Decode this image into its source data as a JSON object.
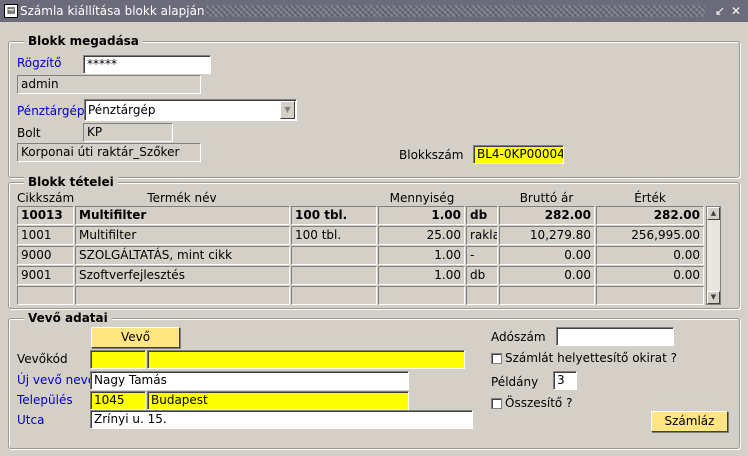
{
  "window": {
    "title": "Számla kiállítása blokk alapján",
    "icon": "oracle-forms-icon",
    "controls": [
      "↙",
      "✕"
    ]
  },
  "blokk_megadasa": {
    "legend": "Blokk megadása",
    "rogzito_label": "Rögzítő",
    "rogzito_value": "*****",
    "user": "admin",
    "penztargep_label": "Pénztárgép",
    "penztargep_value": "Pénztárgép",
    "bolt_label": "Bolt",
    "bolt_value": "KP",
    "raktar": "Korponai úti raktár_Szőker",
    "blokkszam_label": "Blokkszám",
    "blokkszam_value": "BL4-0KP00004"
  },
  "blokk_tetelei": {
    "legend": "Blokk tételei",
    "headers": [
      "Cikkszám",
      "Termék név",
      "Mennyiség",
      "Bruttó ár",
      "Érték"
    ],
    "rows": [
      {
        "cikkszam": "10013",
        "termek": "Multifilter",
        "kiszereles": "100 tbl.",
        "mennyiseg": "1.00",
        "egyseg": "db",
        "brutto": "282.00",
        "ertek": "282.00"
      },
      {
        "cikkszam": "1001",
        "termek": "Multifilter",
        "kiszereles": "100 tbl.",
        "mennyiseg": "25.00",
        "egyseg": "rakla",
        "brutto": "10,279.80",
        "ertek": "256,995.00"
      },
      {
        "cikkszam": "9000",
        "termek": "SZOLGÁLTATÁS, mint cikk",
        "kiszereles": "",
        "mennyiseg": "1.00",
        "egyseg": "-",
        "brutto": "0.00",
        "ertek": "0.00"
      },
      {
        "cikkszam": "9001",
        "termek": "Szoftverfejlesztés",
        "kiszereles": "",
        "mennyiseg": "1.00",
        "egyseg": "db",
        "brutto": "0.00",
        "ertek": "0.00"
      },
      {
        "cikkszam": "",
        "termek": "",
        "kiszereles": "",
        "mennyiseg": "",
        "egyseg": "",
        "brutto": "",
        "ertek": ""
      }
    ]
  },
  "vevo_adatai": {
    "legend": "Vevő adatai",
    "vevo_button": "Vevő",
    "vevokod_label": "Vevőkód",
    "vevokod_value": "",
    "vevokod_name": "",
    "uj_vevo_label": "Új vevő neve",
    "uj_vevo_value": "Nagy Tamás",
    "telepules_label": "Település",
    "irsz": "1045",
    "varos": "Budapest",
    "utca_label": "Utca",
    "utca_value": "Zrínyi u. 15.",
    "adoszam_label": "Adószám",
    "adoszam_value": "",
    "helyettesito_label": "Számlát helyettesítő okirat ?",
    "peldany_label": "Példány",
    "peldany_value": "3",
    "osszesito_label": "Összesítő ?",
    "szamlaz_button": "Számláz"
  }
}
